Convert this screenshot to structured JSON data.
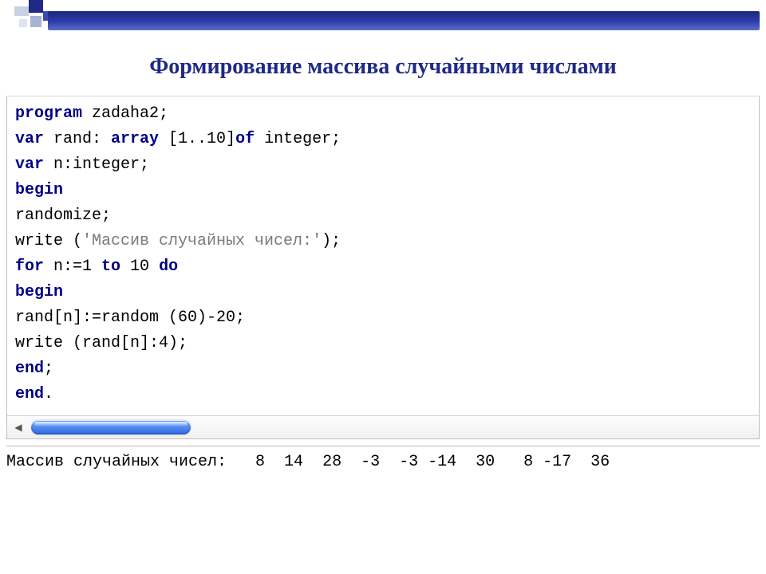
{
  "title": "Формирование массива случайными числами",
  "code": {
    "l1_kw": "program",
    "l1_rest": " zadaha2;",
    "l2_kw1": "var",
    "l2_mid": " rand: ",
    "l2_kw2": "array",
    "l2_mid2": " [1..10]",
    "l2_kw3": "of",
    "l2_end": " integer;",
    "l3_kw": "var",
    "l3_rest": " n:integer;",
    "l4_kw": "begin",
    "l5": "randomize;",
    "l6_a": "write (",
    "l6_str": "'Массив случайных чисел:'",
    "l6_b": ");",
    "l7_kw1": "for",
    "l7_mid1": " n:=1 ",
    "l7_kw2": "to",
    "l7_mid2": " 10 ",
    "l7_kw3": "do",
    "l8_kw": "begin",
    "l9": "rand[n]:=random (60)-20;",
    "l10": "write (rand[n]:4);",
    "l11_kw": "end",
    "l11_b": ";",
    "l12_kw": "end",
    "l12_b": "."
  },
  "scrollbar": {
    "left_glyph": "◀",
    "right_glyph": " "
  },
  "output": "Массив случайных чисел:   8  14  28  -3  -3 -14  30   8 -17  36"
}
